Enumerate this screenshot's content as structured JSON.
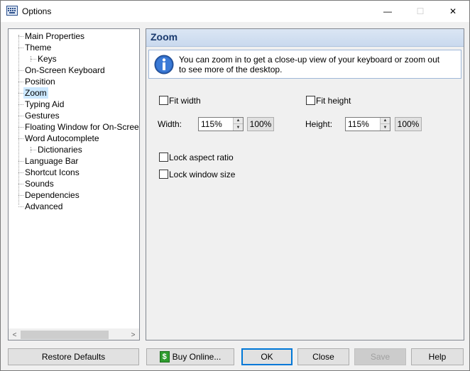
{
  "window": {
    "title": "Options",
    "controls": {
      "minimize": "—",
      "maximize": "☐",
      "close": "✕"
    }
  },
  "tree": {
    "items": [
      {
        "label": "Main Properties",
        "level": 0
      },
      {
        "label": "Theme",
        "level": 0
      },
      {
        "label": "Keys",
        "level": 1
      },
      {
        "label": "On-Screen Keyboard",
        "level": 0
      },
      {
        "label": "Position",
        "level": 0
      },
      {
        "label": "Zoom",
        "level": 0,
        "selected": true
      },
      {
        "label": "Typing Aid",
        "level": 0
      },
      {
        "label": "Gestures",
        "level": 0
      },
      {
        "label": "Floating Window for On-Screen Keyboard",
        "level": 0
      },
      {
        "label": "Word Autocomplete",
        "level": 0
      },
      {
        "label": "Dictionaries",
        "level": 1
      },
      {
        "label": "Language Bar",
        "level": 0
      },
      {
        "label": "Shortcut Icons",
        "level": 0
      },
      {
        "label": "Sounds",
        "level": 0
      },
      {
        "label": "Dependencies",
        "level": 0
      },
      {
        "label": "Advanced",
        "level": 0
      }
    ],
    "scroll_left": "<",
    "scroll_right": ">"
  },
  "panel": {
    "title": "Zoom",
    "info": "You can zoom in to get a close-up view of your keyboard or zoom out to see more of the desktop.",
    "fit_width": {
      "label": "Fit width",
      "checked": false
    },
    "fit_height": {
      "label": "Fit height",
      "checked": false
    },
    "width": {
      "label": "Width:",
      "value": "115%",
      "reset": "100%"
    },
    "height": {
      "label": "Height:",
      "value": "115%",
      "reset": "100%"
    },
    "lock_aspect": {
      "label": "Lock aspect ratio",
      "checked": false
    },
    "lock_size": {
      "label": "Lock window size",
      "checked": false
    }
  },
  "buttons": {
    "restore": "Restore Defaults",
    "buy": "Buy Online...",
    "ok": "OK",
    "close": "Close",
    "save": "Save",
    "help": "Help"
  }
}
